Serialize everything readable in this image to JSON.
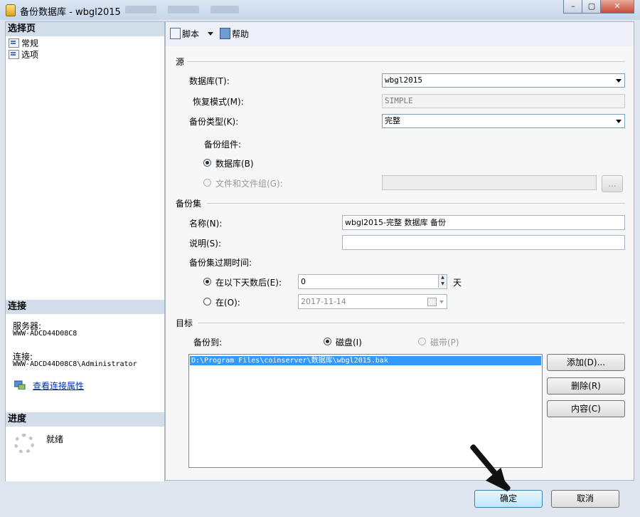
{
  "window": {
    "title": "备份数据库 - wbgl2015",
    "min": "–",
    "max": "▢",
    "close": "✕"
  },
  "left": {
    "select_page": "选择页",
    "nav": [
      "常规",
      "选项"
    ],
    "connection": {
      "header": "连接",
      "server_label": "服务器:",
      "server_value": "WWW-ADCD44D08C8",
      "conn_label": "连接:",
      "conn_value": "WWW-ADCD44D08C8\\Administrator",
      "view_link": "查看连接属性"
    },
    "progress": {
      "header": "进度",
      "status": "就绪"
    }
  },
  "toolbar": {
    "script": "脚本",
    "help": "帮助"
  },
  "source": {
    "title": "源",
    "database_label": "数据库(T):",
    "database_value": "wbgl2015",
    "recovery_label": "恢复模式(M):",
    "recovery_value": "SIMPLE",
    "backup_type_label": "备份类型(K):",
    "backup_type_value": "完整",
    "component_label": "备份组件:",
    "comp_database": "数据库(B)",
    "comp_files": "文件和文件组(G):",
    "browse": "..."
  },
  "backupset": {
    "title": "备份集",
    "name_label": "名称(N):",
    "name_value": "wbgl2015-完整 数据库 备份",
    "desc_label": "说明(S):",
    "desc_value": "",
    "expire_label": "备份集过期时间:",
    "after_days_label": "在以下天数后(E):",
    "after_days_value": "0",
    "days_unit": "天",
    "on_label": "在(O):",
    "on_value": "2017-11-14"
  },
  "destination": {
    "title": "目标",
    "backup_to": "备份到:",
    "disk": "磁盘(I)",
    "tape": "磁带(P)",
    "paths": [
      "D:\\Program Files\\coinserver\\数据库\\wbgl2015.bak"
    ],
    "add": "添加(D)...",
    "remove": "删除(R)",
    "contents": "内容(C)"
  },
  "footer": {
    "ok": "确定",
    "cancel": "取消"
  },
  "colors": {
    "accent": "#3399ff",
    "title_bar": "#c7d6ea"
  }
}
